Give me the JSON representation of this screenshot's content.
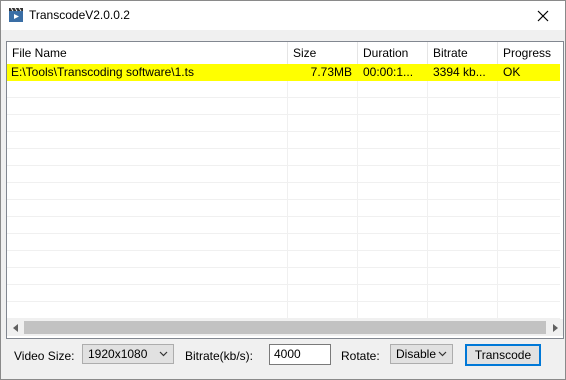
{
  "window": {
    "title": "TranscodeV2.0.0.2"
  },
  "columns": [
    "File Name",
    "Size",
    "Duration",
    "Bitrate",
    "Progress"
  ],
  "rows": [
    {
      "file": "E:\\Tools\\Transcoding software\\1.ts",
      "size": "7.73MB",
      "duration": "00:00:1...",
      "bitrate": "3394 kb...",
      "progress": "OK",
      "selected": true
    }
  ],
  "controls": {
    "video_size_label": "Video Size:",
    "video_size_value": "1920x1080",
    "bitrate_label": "Bitrate(kb/s):",
    "bitrate_value": "4000",
    "rotate_label": "Rotate:",
    "rotate_value": "Disable",
    "transcode_label": "Transcode"
  },
  "colors": {
    "selected_row": "#ffff00",
    "button_border": "#0078d7"
  }
}
